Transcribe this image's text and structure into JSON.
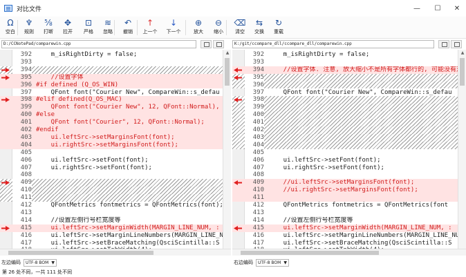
{
  "window": {
    "title": "对比文件",
    "minimize_glyph": "—",
    "maximize_glyph": "☐",
    "close_glyph": "✕"
  },
  "toolbar": [
    {
      "name": "blank",
      "label": "空白",
      "glyph": "Ω",
      "tone": ""
    },
    {
      "name": "rule",
      "label": "规则",
      "glyph": "♆",
      "tone": ""
    },
    {
      "name": "break",
      "label": "打断",
      "glyph": "⅝",
      "tone": ""
    },
    {
      "name": "open",
      "label": "拉开",
      "glyph": "✥",
      "tone": ""
    },
    {
      "name": "strict",
      "label": "严格",
      "glyph": "⊡",
      "tone": ""
    },
    {
      "name": "ignore",
      "label": "忽略",
      "glyph": "≋",
      "tone": ""
    },
    {
      "name": "undo",
      "label": "撤销",
      "glyph": "↶",
      "tone": ""
    },
    {
      "name": "prev",
      "label": "上一个",
      "glyph": "↑",
      "tone": "red"
    },
    {
      "name": "next",
      "label": "下一个",
      "glyph": "↓",
      "tone": "blue"
    },
    {
      "name": "zoom-in",
      "label": "放大",
      "glyph": "⊕",
      "tone": ""
    },
    {
      "name": "zoom-out",
      "label": "缩小",
      "glyph": "⊖",
      "tone": ""
    },
    {
      "name": "clear",
      "label": "清空",
      "glyph": "⌫",
      "tone": ""
    },
    {
      "name": "swap",
      "label": "交换",
      "glyph": "⇆",
      "tone": ""
    },
    {
      "name": "reload",
      "label": "重载",
      "glyph": "↻",
      "tone": ""
    }
  ],
  "left": {
    "path": "D:/CCNotePad/comparewin.cpp",
    "encoding_label": "左边编码",
    "encoding_value": "UTF-8 BOM"
  },
  "right": {
    "path": "K:/git/ccompare_dll/ccompare_dll/comparewin.cpp",
    "encoding_label": "右边编码",
    "encoding_value": "UTF-8 BOM"
  },
  "left_lines": [
    {
      "ln": "392",
      "code": "    m_isRightDirty = false;",
      "type": "normal",
      "mark": ""
    },
    {
      "ln": "393",
      "code": "",
      "type": "normal",
      "mark": ""
    },
    {
      "ln": "394",
      "code": "",
      "type": "hatch",
      "mark": "right-arrow"
    },
    {
      "ln": "395",
      "code": "    //设置字体",
      "type": "changed",
      "mark": "right-arrow"
    },
    {
      "ln": "396",
      "code": "#if defined (Q_OS_WIN)",
      "type": "changed",
      "mark": ""
    },
    {
      "ln": "397",
      "code": "    QFont font(\"Courier New\", CompareWin::s_defau",
      "type": "normal",
      "mark": ""
    },
    {
      "ln": "398",
      "code": "#elif defined(Q_OS_MAC)",
      "type": "changed",
      "mark": "right-arrow"
    },
    {
      "ln": "399",
      "code": "    QFont font(\"Courier New\", 12, QFont::Normal),",
      "type": "changed",
      "mark": ""
    },
    {
      "ln": "400",
      "code": "#else",
      "type": "changed",
      "mark": ""
    },
    {
      "ln": "401",
      "code": "    QFont font(\"Courier\", 12, QFont::Normal);",
      "type": "changed",
      "mark": ""
    },
    {
      "ln": "402",
      "code": "#endif",
      "type": "changed",
      "mark": ""
    },
    {
      "ln": "403",
      "code": "    ui.leftSrc->setMarginsFont(font);",
      "type": "changed",
      "mark": ""
    },
    {
      "ln": "404",
      "code": "    ui.rightSrc->setMarginsFont(font);",
      "type": "changed",
      "mark": ""
    },
    {
      "ln": "405",
      "code": "",
      "type": "normal",
      "mark": ""
    },
    {
      "ln": "406",
      "code": "    ui.leftSrc->setFont(font);",
      "type": "normal",
      "mark": ""
    },
    {
      "ln": "407",
      "code": "    ui.rightSrc->setFont(font);",
      "type": "normal",
      "mark": ""
    },
    {
      "ln": "408",
      "code": "",
      "type": "normal",
      "mark": ""
    },
    {
      "ln": "409",
      "code": "",
      "type": "hatch",
      "mark": "right-arrow"
    },
    {
      "ln": "410",
      "code": "",
      "type": "hatch",
      "mark": ""
    },
    {
      "ln": "411",
      "code": "",
      "type": "hatch",
      "mark": ""
    },
    {
      "ln": "412",
      "code": "    QFontMetrics fontmetrics = QFontMetrics(font);",
      "type": "normal",
      "mark": ""
    },
    {
      "ln": "413",
      "code": "",
      "type": "normal",
      "mark": ""
    },
    {
      "ln": "414",
      "code": "    //设置左侧行号栏宽度等",
      "type": "normal",
      "mark": ""
    },
    {
      "ln": "415",
      "code": "    ui.leftSrc->setMarginWidth(MARGIN_LINE_NUM, :",
      "type": "changed",
      "mark": "right-arrow"
    },
    {
      "ln": "416",
      "code": "    ui.leftSrc->setMarginLineNumbers(MARGIN_LINE_NUM,",
      "type": "normal",
      "mark": ""
    },
    {
      "ln": "417",
      "code": "    ui.leftSrc->setBraceMatching(QsciScintilla::S",
      "type": "normal",
      "mark": ""
    },
    {
      "ln": "418",
      "code": "    ui.leftSrc->setTabWidth(4);",
      "type": "normal",
      "mark": ""
    }
  ],
  "right_lines": [
    {
      "ln": "392",
      "code": "    m_isRightDirty = false;",
      "type": "normal",
      "mark": ""
    },
    {
      "ln": "393",
      "code": "",
      "type": "normal",
      "mark": ""
    },
    {
      "ln": "394",
      "code": "    //设置字体. 注意, 放大缩小不是所有字体都行的, 可能没有对",
      "type": "changed",
      "mark": "left-arrow"
    },
    {
      "ln": "395",
      "code": "",
      "type": "hatch",
      "mark": "left-arrow"
    },
    {
      "ln": "396",
      "code": "",
      "type": "hatch",
      "mark": ""
    },
    {
      "ln": "397",
      "code": "    QFont font(\"Courier New\", CompareWin::s_defau",
      "type": "normal",
      "mark": ""
    },
    {
      "ln": "398",
      "code": "",
      "type": "hatch",
      "mark": "left-arrow"
    },
    {
      "ln": "399",
      "code": "",
      "type": "hatch",
      "mark": ""
    },
    {
      "ln": "400",
      "code": "",
      "type": "hatch",
      "mark": ""
    },
    {
      "ln": "401",
      "code": "",
      "type": "hatch",
      "mark": ""
    },
    {
      "ln": "402",
      "code": "",
      "type": "hatch",
      "mark": ""
    },
    {
      "ln": "403",
      "code": "",
      "type": "hatch",
      "mark": ""
    },
    {
      "ln": "404",
      "code": "",
      "type": "hatch",
      "mark": ""
    },
    {
      "ln": "405",
      "code": "",
      "type": "normal",
      "mark": ""
    },
    {
      "ln": "406",
      "code": "    ui.leftSrc->setFont(font);",
      "type": "normal",
      "mark": ""
    },
    {
      "ln": "407",
      "code": "    ui.rightSrc->setFont(font);",
      "type": "normal",
      "mark": ""
    },
    {
      "ln": "408",
      "code": "",
      "type": "normal",
      "mark": ""
    },
    {
      "ln": "409",
      "code": "    //ui.leftSrc->setMarginsFont(font);",
      "type": "changed",
      "mark": "left-arrow"
    },
    {
      "ln": "410",
      "code": "    //ui.rightSrc->setMarginsFont(font);",
      "type": "changed",
      "mark": ""
    },
    {
      "ln": "411",
      "code": "",
      "type": "changed",
      "mark": ""
    },
    {
      "ln": "412",
      "code": "    QFontMetrics fontmetrics = QFontMetrics(font",
      "type": "normal",
      "mark": ""
    },
    {
      "ln": "413",
      "code": "",
      "type": "normal",
      "mark": ""
    },
    {
      "ln": "414",
      "code": "    //设置左侧行号栏宽度等",
      "type": "normal",
      "mark": ""
    },
    {
      "ln": "415",
      "code": "    ui.leftSrc->setMarginWidth(MARGIN_LINE_NUM, :",
      "type": "changed",
      "mark": "left-arrow"
    },
    {
      "ln": "416",
      "code": "    ui.leftSrc->setMarginLineNumbers(MARGIN_LINE_NUM,",
      "type": "normal",
      "mark": ""
    },
    {
      "ln": "417",
      "code": "    ui.leftSrc->setBraceMatching(QsciScintilla::S",
      "type": "normal",
      "mark": ""
    },
    {
      "ln": "418",
      "code": "    ui.leftSrc->setTabWidth(4);",
      "type": "normal",
      "mark": ""
    }
  ],
  "status": {
    "text": "第 26 处不同，一共 111 处不同"
  },
  "colors": {
    "diff_bg": "#ffe3e3",
    "diff_text": "#d11a1a",
    "marker": "#e02020"
  }
}
